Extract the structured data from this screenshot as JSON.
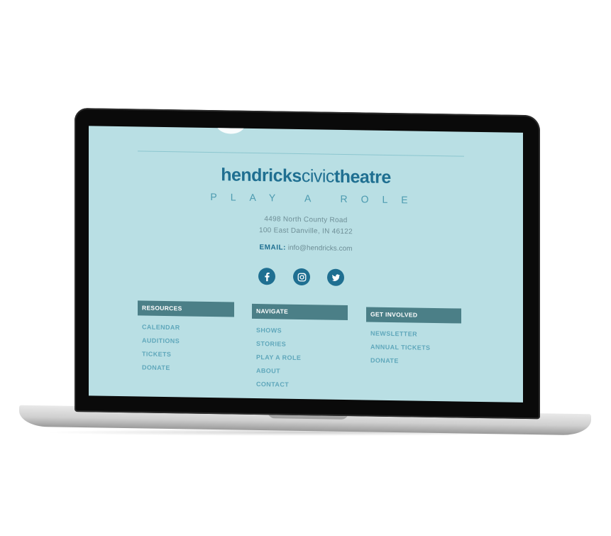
{
  "brand": {
    "logo_part1": "hendricks",
    "logo_part2": "civic",
    "logo_part3": "theatre",
    "tagline": "PLAY A ROLE"
  },
  "contact": {
    "address_line1": "4498 North County Road",
    "address_line2": "100 East Danville, IN 46122",
    "email_label": "EMAIL:",
    "email_value": "info@hendricks.com"
  },
  "social": [
    {
      "icon": "facebook-icon"
    },
    {
      "icon": "instagram-icon"
    },
    {
      "icon": "twitter-icon"
    }
  ],
  "columns": {
    "resources": {
      "title": "RESOURCES",
      "links": [
        "CALENDAR",
        "AUDITIONS",
        "TICKETS",
        "DONATE"
      ]
    },
    "navigate": {
      "title": "NAVIGATE",
      "links": [
        "SHOWS",
        "STORIES",
        "PLAY A ROLE",
        "ABOUT",
        "CONTACT"
      ]
    },
    "get_involved": {
      "title": "GET INVOLVED",
      "links": [
        "NEWSLETTER",
        "ANNUAL TICKETS",
        "DONATE"
      ]
    }
  },
  "colors": {
    "page_background": "#b9dfe4",
    "brand_blue": "#1f6f91",
    "header_bar": "#4b7f87",
    "link": "#5fa7bb"
  }
}
